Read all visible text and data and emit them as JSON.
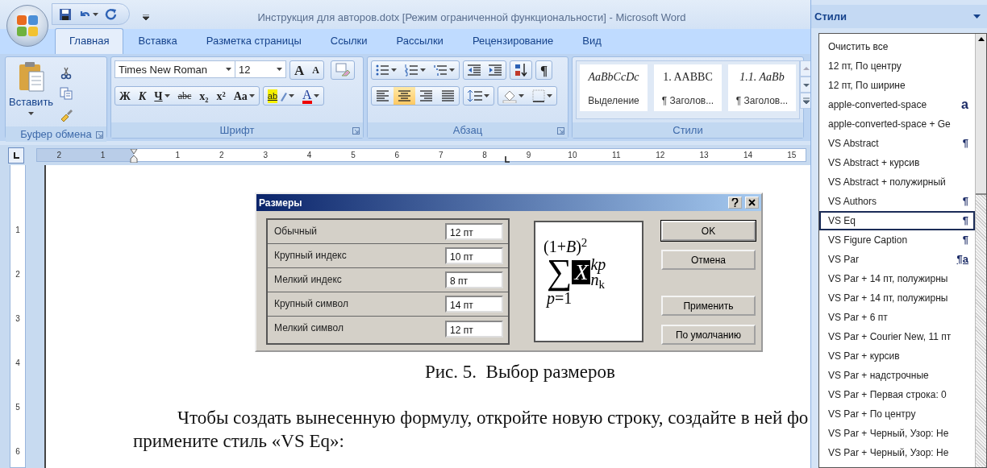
{
  "window": {
    "title": "Инструкция для авторов.dotx [Режим ограниченной функциональности] - Microsoft Word"
  },
  "tabs": [
    {
      "label": "Главная",
      "selected": true
    },
    {
      "label": "Вставка",
      "selected": false
    },
    {
      "label": "Разметка страницы",
      "selected": false
    },
    {
      "label": "Ссылки",
      "selected": false
    },
    {
      "label": "Рассылки",
      "selected": false
    },
    {
      "label": "Рецензирование",
      "selected": false
    },
    {
      "label": "Вид",
      "selected": false
    }
  ],
  "ribbon": {
    "clipboard": {
      "paste_label": "Вставить",
      "group_label": "Буфер обмена"
    },
    "font": {
      "font_name": "Times New Roman",
      "font_size": "12",
      "grow_label": "A",
      "shrink_label": "A",
      "format_buttons": [
        {
          "kind": "bold",
          "label": "Ж",
          "dropdown": false
        },
        {
          "kind": "italic",
          "label": "К",
          "dropdown": false
        },
        {
          "kind": "underline",
          "label": "Ч",
          "dropdown": true
        },
        {
          "kind": "strike",
          "label": "abc",
          "dropdown": false
        },
        {
          "kind": "sub",
          "label": "x₂",
          "dropdown": false
        },
        {
          "kind": "sup",
          "label": "x²",
          "dropdown": false
        },
        {
          "kind": "case",
          "label": "Aa",
          "dropdown": true
        }
      ],
      "highlight_label": "ab",
      "color_label": "A",
      "group_label": "Шрифт"
    },
    "paragraph": {
      "alignments": [
        {
          "kind": "left",
          "selected": false
        },
        {
          "kind": "center",
          "selected": true
        },
        {
          "kind": "right",
          "selected": false
        },
        {
          "kind": "justify",
          "selected": false
        }
      ],
      "marks_label": "¶",
      "group_label": "Абзац"
    },
    "styles": {
      "items": [
        {
          "kind": "italic",
          "sample": "AaBbCcDc",
          "name": "Выделение"
        },
        {
          "kind": "upright",
          "sample": "1.  AABBC",
          "name": "¶ Заголов..."
        },
        {
          "kind": "italic",
          "sample": "1.1.  AaBb",
          "name": "¶ Заголов..."
        }
      ],
      "group_label": "Стили"
    }
  },
  "ruler": {
    "left_labels": [
      "2",
      "1"
    ],
    "right_labels": [
      "1",
      "2",
      "3",
      "4",
      "5",
      "6",
      "7",
      "8",
      "9",
      "10",
      "11",
      "12",
      "13",
      "14",
      "15"
    ],
    "vertical_labels": [
      "1",
      "2",
      "3",
      "4",
      "5",
      "6"
    ]
  },
  "dialog": {
    "title": "Размеры",
    "rows": [
      {
        "label": "Обычный",
        "value": "12 пт"
      },
      {
        "label": "Крупный индекс",
        "value": "10 пт"
      },
      {
        "label": "Мелкий индекс",
        "value": "8 пт"
      },
      {
        "label": "Крупный символ",
        "value": "14 пт"
      },
      {
        "label": "Мелкий символ",
        "value": "12 пт"
      }
    ],
    "preview": {
      "top": "(1+*B*)$^{2}$",
      "sigma": "∑",
      "symbol": "X",
      "upper": "kp",
      "lower": "*n*$_{k}$",
      "limit": "*p*=1"
    },
    "buttons": [
      {
        "label": "OK",
        "default": true
      },
      {
        "label": "Отмена",
        "default": false
      },
      {
        "label": "Применить",
        "default": false
      },
      {
        "label": "По умолчанию",
        "default": false
      }
    ]
  },
  "document": {
    "caption": "Рис. 5.  Выбор размеров",
    "lines": [
      "Чтобы создать вынесенную формулу, откройте новую строку, создайте в ней фо",
      "примените стиль «VS Eq»:"
    ]
  },
  "styles_pane": {
    "title": "Стили",
    "items": [
      {
        "name": "Очистить все",
        "selected": false
      },
      {
        "name": "12 пт, По центру",
        "selected": false
      },
      {
        "name": "12 пт, По ширине",
        "selected": false
      },
      {
        "name": "apple-converted-space",
        "kind": "character",
        "marker": "a",
        "selected": false
      },
      {
        "name": "apple-converted-space + Ge",
        "selected": false
      },
      {
        "name": "VS Abstract",
        "kind": "paragraph",
        "marker": "¶",
        "selected": false
      },
      {
        "name": "VS Abstract + курсив",
        "selected": false
      },
      {
        "name": "VS Abstract + полужирный",
        "selected": false
      },
      {
        "name": "VS Authors",
        "kind": "paragraph",
        "marker": "¶",
        "selected": false
      },
      {
        "name": "VS Eq",
        "kind": "paragraph",
        "marker": "¶",
        "selected": true
      },
      {
        "name": "VS Figure Caption",
        "kind": "paragraph",
        "marker": "¶",
        "selected": false
      },
      {
        "name": "VS Par",
        "kind": "linked",
        "marker": "¶a",
        "selected": false
      },
      {
        "name": "VS Par + 14 пт, полужирны",
        "selected": false
      },
      {
        "name": "VS Par + 14 пт, полужирны",
        "selected": false
      },
      {
        "name": "VS Par + 6 пт",
        "selected": false
      },
      {
        "name": "VS Par + Courier New, 11 пт",
        "selected": false
      },
      {
        "name": "VS Par + курсив",
        "selected": false
      },
      {
        "name": "VS Par + надстрочные",
        "selected": false
      },
      {
        "name": "VS Par + Первая строка:  0",
        "selected": false
      },
      {
        "name": "VS Par + По центру",
        "selected": false
      },
      {
        "name": "VS Par + Черный, Узор: Не",
        "selected": false
      },
      {
        "name": "VS Par + Черный, Узор: Не",
        "selected": false
      }
    ]
  }
}
